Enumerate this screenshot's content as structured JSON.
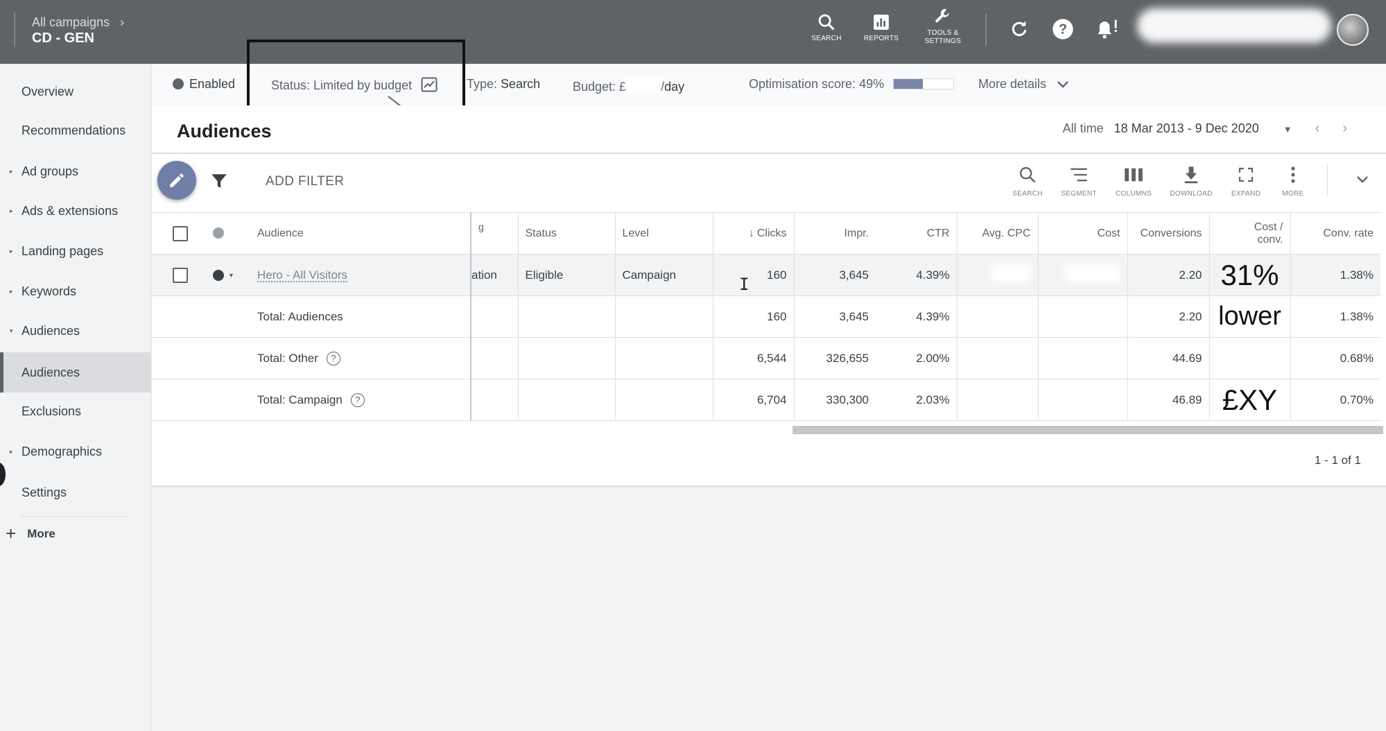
{
  "topbar": {
    "breadcrumb_parent": "All campaigns",
    "campaign_name": "CD - GEN",
    "tools": [
      {
        "label": "SEARCH",
        "icon": "search-icon"
      },
      {
        "label": "REPORTS",
        "icon": "reports-icon"
      },
      {
        "label": "TOOLS &",
        "label2": "SETTINGS",
        "icon": "wrench-icon"
      }
    ]
  },
  "sidebar": {
    "items": [
      {
        "label": "Overview",
        "caret": ""
      },
      {
        "label": "Recommendations",
        "caret": ""
      },
      {
        "label": "Ad groups",
        "caret": "▸"
      },
      {
        "label": "Ads & extensions",
        "caret": "▸"
      },
      {
        "label": "Landing pages",
        "caret": "▸"
      },
      {
        "label": "Keywords",
        "caret": "▸"
      },
      {
        "label": "Audiences",
        "caret": "▾"
      },
      {
        "label": "Audiences",
        "caret": ""
      },
      {
        "label": "Exclusions",
        "caret": ""
      },
      {
        "label": "Demographics",
        "caret": "▸"
      },
      {
        "label": "Settings",
        "caret": ""
      }
    ],
    "more_label": "More"
  },
  "status_bar": {
    "enabled": "Enabled",
    "status_label": "Status:",
    "status_value": "Limited by budget",
    "type_label": "Type:",
    "type_value": "Search",
    "budget_label": "Budget: £",
    "budget_suffix": "/day",
    "opt_label": "Optimisation score:",
    "opt_value": "49%",
    "opt_fraction": 0.49,
    "more_details": "More details"
  },
  "main": {
    "title": "Audiences",
    "date_label": "All time",
    "date_range": "18 Mar 2013 - 9 Dec 2020",
    "add_filter": "ADD FILTER",
    "toolbar": [
      "SEARCH",
      "SEGMENT",
      "COLUMNS",
      "DOWNLOAD",
      "EXPAND",
      "MORE"
    ]
  },
  "table": {
    "headers": {
      "audience": "Audience",
      "targeting": "g",
      "status": "Status",
      "level": "Level",
      "clicks": "Clicks",
      "impr": "Impr.",
      "ctr": "CTR",
      "avg_cpc": "Avg. CPC",
      "cost": "Cost",
      "conversions": "Conversions",
      "cost_conv_1": "Cost /",
      "cost_conv_2": "conv.",
      "conv_rate": "Conv. rate"
    },
    "row": {
      "audience": "Hero - All Visitors",
      "targeting": "ation",
      "status": "Eligible",
      "level": "Campaign",
      "clicks": "160",
      "impr": "3,645",
      "ctr": "4.39%",
      "conversions": "2.20",
      "cost_conv": "31%",
      "conv_rate": "1.38%"
    },
    "total_audiences": {
      "label": "Total: Audiences",
      "clicks": "160",
      "impr": "3,645",
      "ctr": "4.39%",
      "conversions": "2.20",
      "cost_conv": "lower",
      "conv_rate": "1.38%"
    },
    "total_other": {
      "label": "Total: Other",
      "clicks": "6,544",
      "impr": "326,655",
      "ctr": "2.00%",
      "conversions": "44.69",
      "conv_rate": "0.68%"
    },
    "total_campaign": {
      "label": "Total: Campaign",
      "clicks": "6,704",
      "impr": "330,300",
      "ctr": "2.03%",
      "conversions": "46.89",
      "cost_conv": "£XY",
      "conv_rate": "0.70%"
    },
    "pager": "1 - 1 of 1"
  }
}
